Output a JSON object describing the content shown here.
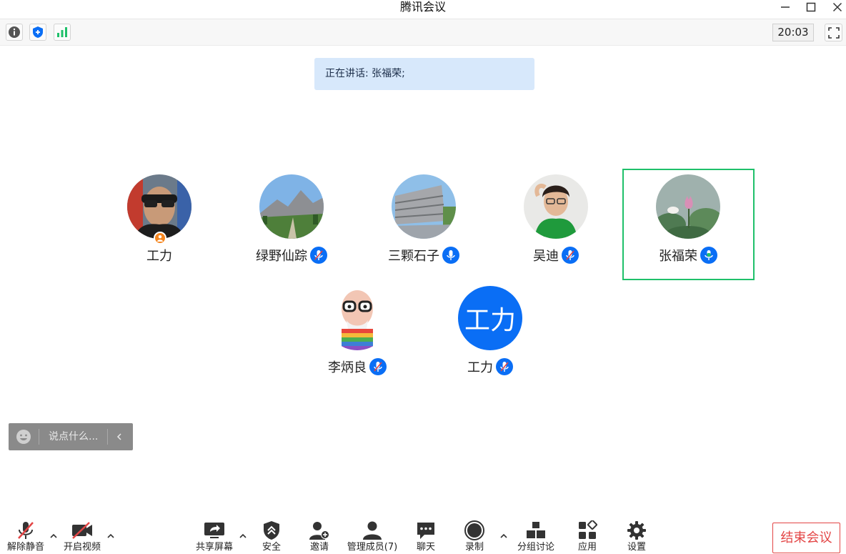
{
  "window": {
    "title": "腾讯会议"
  },
  "infobar": {
    "time": "20:03"
  },
  "speaking": {
    "text": "正在讲话: 张福荣;"
  },
  "participants": [
    {
      "name": "工力",
      "mic": "none",
      "host": true
    },
    {
      "name": "绿野仙踪",
      "mic": "muted"
    },
    {
      "name": "三颗石子",
      "mic": "on"
    },
    {
      "name": "吴迪",
      "mic": "muted"
    },
    {
      "name": "张福荣",
      "mic": "speaking",
      "active": true
    },
    {
      "name": "李炳良",
      "mic": "muted"
    },
    {
      "name": "工力",
      "mic": "muted",
      "avatar_text": "工力"
    }
  ],
  "chat": {
    "placeholder": "说点什么..."
  },
  "toolbar": {
    "unmute": "解除静音",
    "video": "开启视频",
    "share": "共享屏幕",
    "security": "安全",
    "invite": "邀请",
    "members": "管理成员(7)",
    "chat": "聊天",
    "record": "录制",
    "breakout": "分组讨论",
    "apps": "应用",
    "settings": "设置",
    "end": "结束会议"
  },
  "colors": {
    "accent": "#0a6ef5",
    "active": "#1fc06a",
    "danger": "#e34545",
    "host": "#f5861f"
  }
}
